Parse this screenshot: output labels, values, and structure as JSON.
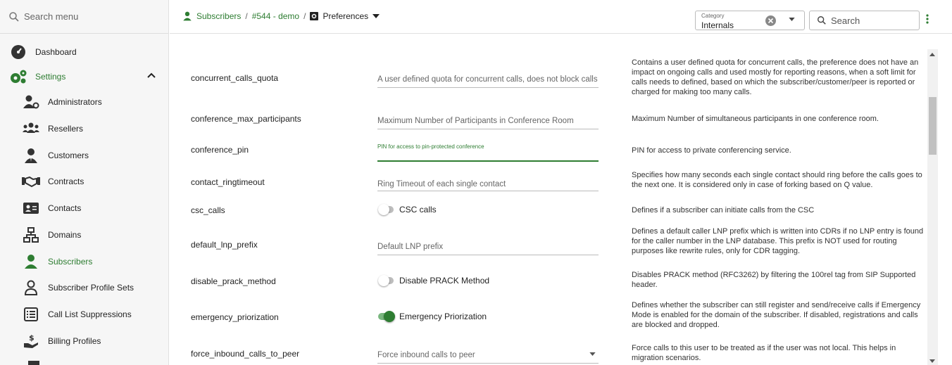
{
  "sidebar": {
    "search_placeholder": "Search menu",
    "items": [
      {
        "label": "Dashboard",
        "icon": "dashboard-gauge-icon"
      },
      {
        "label": "Settings",
        "icon": "cogs-icon"
      },
      {
        "label": "Administrators",
        "icon": "admin-user-gear-icon"
      },
      {
        "label": "Resellers",
        "icon": "users-group-icon"
      },
      {
        "label": "Customers",
        "icon": "customer-user-icon"
      },
      {
        "label": "Contracts",
        "icon": "handshake-icon"
      },
      {
        "label": "Contacts",
        "icon": "contact-card-icon"
      },
      {
        "label": "Domains",
        "icon": "sitemap-icon"
      },
      {
        "label": "Subscribers",
        "icon": "subscriber-user-icon"
      },
      {
        "label": "Subscriber Profile Sets",
        "icon": "user-outline-icon"
      },
      {
        "label": "Call List Suppressions",
        "icon": "list-box-icon"
      },
      {
        "label": "Billing Profiles",
        "icon": "hand-dollar-icon"
      }
    ]
  },
  "breadcrumb": {
    "items": [
      "Subscribers",
      "#544 - demo",
      "Preferences"
    ]
  },
  "filter": {
    "category_label": "Category",
    "category_value": "Internals",
    "search_placeholder": "Search"
  },
  "preferences": [
    {
      "name": "concurrent_calls_quota",
      "placeholder": "A user defined quota for concurrent calls, does not block calls",
      "description": "Contains a user defined quota for concurrent calls, the preference does not have an impact on ongoing calls and used mostly for reporting reasons, when a soft limit for calls needs to defined, based on which the subscriber/customer/peer is reported or charged for making too many calls."
    },
    {
      "name": "conference_max_participants",
      "placeholder": "Maximum Number of Participants in Conference Room",
      "description": "Maximum Number of simultaneous participants in one conference room."
    },
    {
      "name": "conference_pin",
      "placeholder": "PIN for access to pin-protected conference",
      "description": "PIN for access to private conferencing service."
    },
    {
      "name": "contact_ringtimeout",
      "placeholder": "Ring Timeout of each single contact",
      "description": "Specifies how many seconds each single contact should ring before the calls goes to the next one. It is considered only in case of forking based on Q value."
    },
    {
      "name": "csc_calls",
      "toggle_label": "CSC calls",
      "toggle_on": false,
      "description": "Defines if a subscriber can initiate calls from the CSC"
    },
    {
      "name": "default_lnp_prefix",
      "placeholder": "Default LNP prefix",
      "description": "Defines a default caller LNP prefix which is written into CDRs if no LNP entry is found for the caller number in the LNP database. This prefix is NOT used for routing purposes like rewrite rules, only for CDR tagging."
    },
    {
      "name": "disable_prack_method",
      "toggle_label": "Disable PRACK Method",
      "toggle_on": false,
      "description": "Disables PRACK method (RFC3262) by filtering the 100rel tag from SIP Supported header."
    },
    {
      "name": "emergency_priorization",
      "toggle_label": "Emergency Priorization",
      "toggle_on": true,
      "description": "Defines whether the subscriber can still register and send/receive calls if Emergency Mode is enabled for the domain of the subscriber. If disabled, registrations and calls are blocked and dropped."
    },
    {
      "name": "force_inbound_calls_to_peer",
      "placeholder": "Force inbound calls to peer",
      "description": "Force calls to this user to be treated as if the user was not local. This helps in migration scenarios."
    }
  ],
  "colors": {
    "accent": "#2e7d32",
    "toggle_track_on": "#7ab77f",
    "toggle_track_off": "#bdbdbd"
  }
}
